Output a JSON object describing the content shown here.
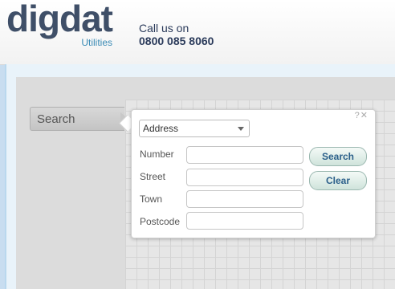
{
  "header": {
    "logo_text": "digdat",
    "logo_subtext": "Utilities",
    "call_label": "Call us on",
    "phone": "0800 085 8060"
  },
  "sidebar": {
    "search_tab_label": "Search"
  },
  "search_panel": {
    "help_close": "?✕",
    "type_select": {
      "selected": "Address"
    },
    "fields": {
      "number_label": "Number",
      "street_label": "Street",
      "town_label": "Town",
      "postcode_label": "Postcode"
    },
    "search_button": "Search",
    "clear_button": "Clear"
  }
}
